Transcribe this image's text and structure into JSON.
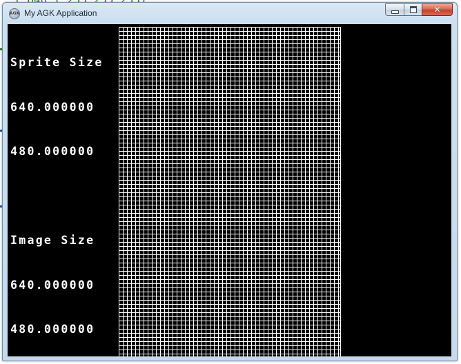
{
  "background": {
    "code_fragment": "Y 640  Y 255 255 255)"
  },
  "window": {
    "title": "My AGK Application",
    "app_icon": "agk-app-icon",
    "app_icon_text": "AGK",
    "buttons": {
      "minimize": "minimize-icon",
      "maximize": "maximize-icon",
      "close": "close-icon",
      "close_glyph": "✕"
    }
  },
  "app": {
    "sprite_label": "Sprite Size",
    "sprite_width": "640.000000",
    "sprite_height": "480.000000",
    "image_label": "Image Size",
    "image_width": "640.000000",
    "image_height": "480.000000"
  },
  "colors": {
    "client_background": "#000000",
    "text": "#ffffff",
    "grid_lines": "#ffffff",
    "close_button": "#c4402f"
  }
}
